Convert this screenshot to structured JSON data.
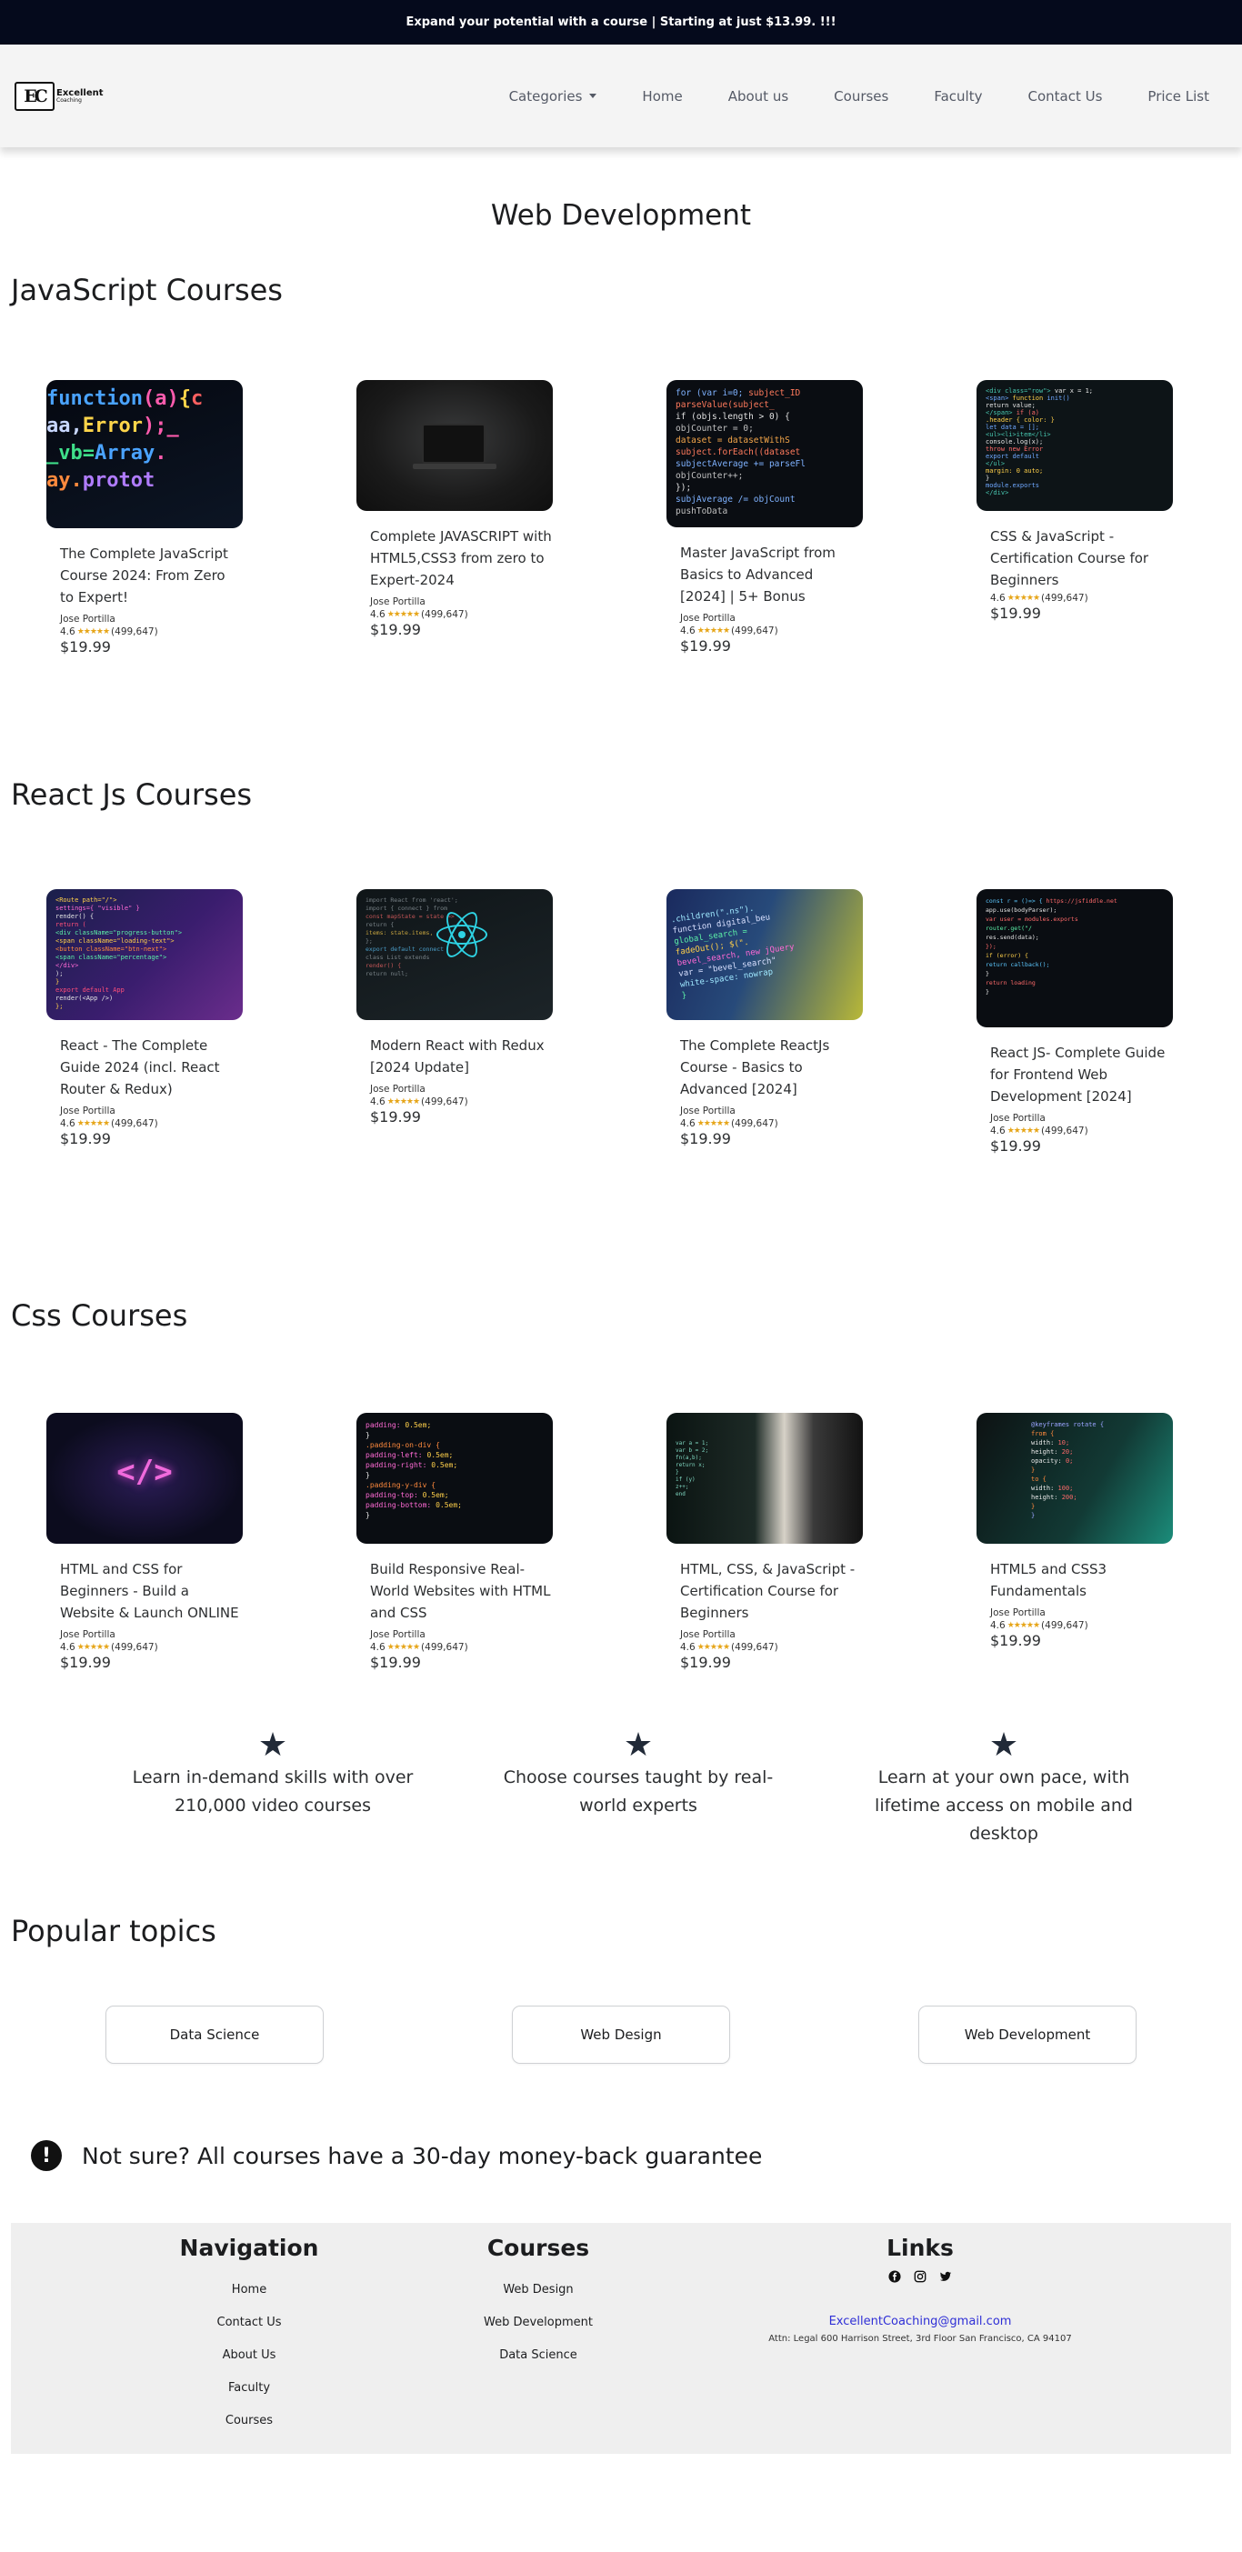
{
  "promo": {
    "text": "Expand your potential with a course | Starting at just $13.99. !!!"
  },
  "brand": {
    "mark": "EC",
    "line1": "Excellent",
    "line2": "Coaching"
  },
  "nav": {
    "items": [
      "Categories",
      "Home",
      "About us",
      "Courses",
      "Faculty",
      "Contact Us",
      "Price List"
    ]
  },
  "page_title": "Web Development",
  "sections": [
    {
      "title": "JavaScript Courses",
      "courses": [
        {
          "title": "The Complete JavaScript Course 2024: From Zero to Expert!",
          "author": "Jose Portilla",
          "rating": "4.6",
          "reviews": "(499,647)",
          "price": "$19.99",
          "thumb": "javascript-code-thumbnail"
        },
        {
          "title": "Complete JAVASCRIPT with HTML5,CSS3 from zero to Expert-2024",
          "author": "Jose Portilla",
          "rating": "4.6",
          "reviews": "(499,647)",
          "price": "$19.99",
          "thumb": "laptop-thumbnail"
        },
        {
          "title": "Master JavaScript from Basics to Advanced [2024] | 5+ Bonus",
          "author": "Jose Portilla",
          "rating": "4.6",
          "reviews": "(499,647)",
          "price": "$19.99",
          "thumb": "code-editor-thumbnail"
        },
        {
          "title": "CSS & JavaScript - Certification Course for Beginners",
          "author": "",
          "rating": "4.6",
          "reviews": "(499,647)",
          "price": "$19.99",
          "thumb": "code-screen-thumbnail"
        }
      ]
    },
    {
      "title": "React Js Courses",
      "courses": [
        {
          "title": "React - The Complete Guide 2024 (incl. React Router & Redux)",
          "author": "Jose Portilla",
          "rating": "4.6",
          "reviews": "(499,647)",
          "price": "$19.99",
          "thumb": "react-code-thumbnail"
        },
        {
          "title": "Modern React with Redux [2024 Update]",
          "author": "Jose Portilla",
          "rating": "4.6",
          "reviews": "(499,647)",
          "price": "$19.99",
          "thumb": "react-logo-thumbnail"
        },
        {
          "title": "The Complete ReactJs Course - Basics to Advanced [2024]",
          "author": "Jose Portilla",
          "rating": "4.6",
          "reviews": "(499,647)",
          "price": "$19.99",
          "thumb": "code-closeup-thumbnail"
        },
        {
          "title": "React JS- Complete Guide for Frontend Web Development [2024]",
          "author": "Jose Portilla",
          "rating": "4.6",
          "reviews": "(499,647)",
          "price": "$19.99",
          "thumb": "dark-code-thumbnail"
        }
      ]
    },
    {
      "title": "Css Courses",
      "courses": [
        {
          "title": "HTML and CSS for Beginners - Build a Website & Launch ONLINE",
          "author": "Jose Portilla",
          "rating": "4.6",
          "reviews": "(499,647)",
          "price": "$19.99",
          "thumb": "html-tag-neon-thumbnail"
        },
        {
          "title": "Build Responsive Real-World Websites with HTML and CSS",
          "author": "Jose Portilla",
          "rating": "4.6",
          "reviews": "(499,647)",
          "price": "$19.99",
          "thumb": "css-code-thumbnail"
        },
        {
          "title": "HTML, CSS, & JavaScript - Certification Course for Beginners",
          "author": "Jose Portilla",
          "rating": "4.6",
          "reviews": "(499,647)",
          "price": "$19.99",
          "thumb": "monitor-thumbnail"
        },
        {
          "title": "HTML5 and CSS3 Fundamentals",
          "author": "Jose Portilla",
          "rating": "4.6",
          "reviews": "(499,647)",
          "price": "$19.99",
          "thumb": "teal-code-thumbnail"
        }
      ]
    }
  ],
  "features": [
    "Learn in-demand skills with over 210,000 video courses",
    "Choose courses taught by real-world experts",
    "Learn at your own pace, with lifetime access on mobile and desktop"
  ],
  "popular": {
    "title": "Popular topics",
    "topics": [
      "Data Science",
      "Web Design",
      "Web Development"
    ]
  },
  "guarantee": "Not sure? All courses have a 30-day money-back guarantee",
  "footer": {
    "navigation": {
      "title": "Navigation",
      "links": [
        "Home",
        "Contact Us",
        "About Us",
        "Faculty",
        "Courses"
      ]
    },
    "courses": {
      "title": "Courses",
      "links": [
        "Web Design",
        "Web Development",
        "Data Science"
      ]
    },
    "links": {
      "title": "Links",
      "social": [
        "facebook-icon",
        "instagram-icon",
        "twitter-icon"
      ],
      "email": "ExcellentCoaching@gmail.com",
      "address": "Attn: Legal 600 Harrison Street, 3rd Floor San Francisco, CA 94107"
    }
  },
  "colors": {
    "promo_bg": "#050a1c",
    "star": "#e6a518",
    "feature_star": "#212a38",
    "email_link": "#2f2fd6"
  }
}
